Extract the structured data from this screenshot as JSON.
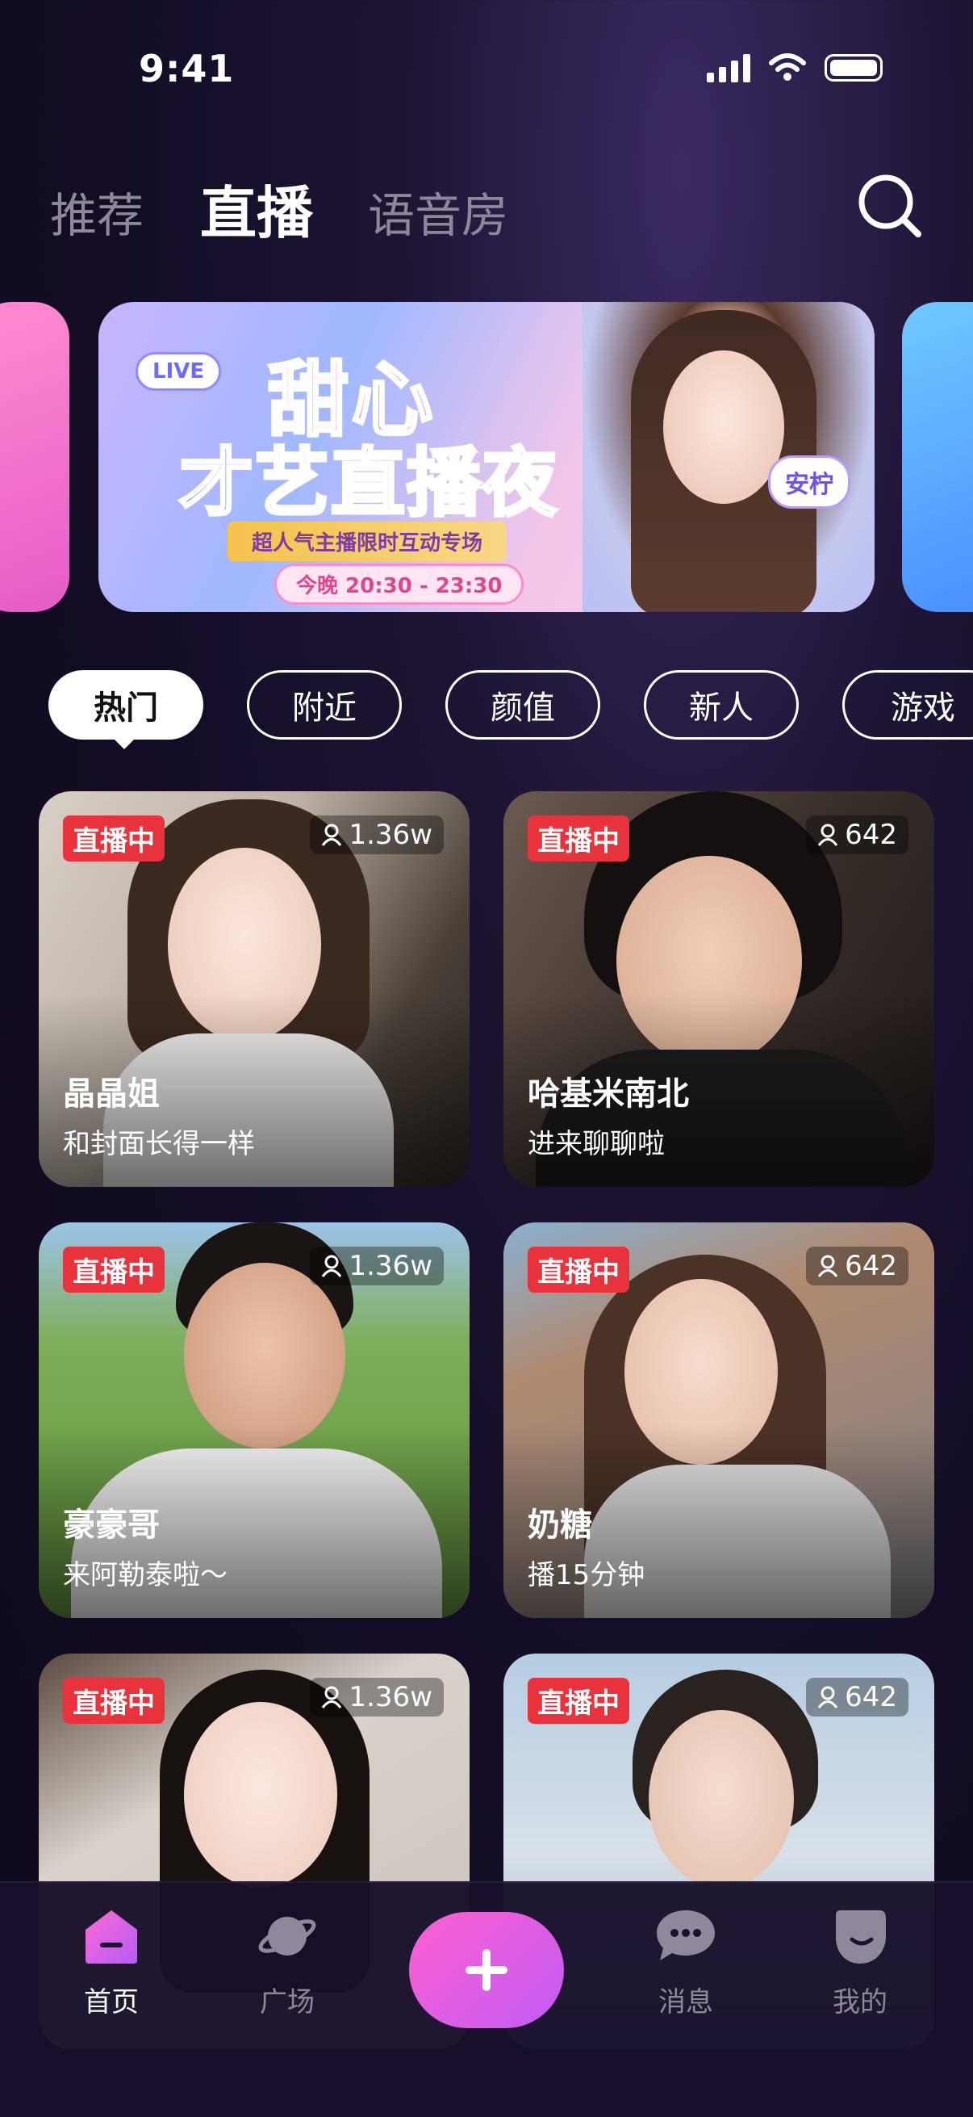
{
  "status_bar": {
    "time": "9:41"
  },
  "top_tabs": [
    {
      "label": "推荐",
      "active": false
    },
    {
      "label": "直播",
      "active": true
    },
    {
      "label": "语音房",
      "active": false
    }
  ],
  "banner": {
    "live_tag": "LIVE",
    "title_line1": "甜心",
    "title_line2": "才艺直播夜",
    "subtitle": "超人气主播限时互动专场",
    "time": "今晚 20:30 - 23:30",
    "host_name": "安柠"
  },
  "categories": [
    {
      "label": "热门",
      "active": true
    },
    {
      "label": "附近",
      "active": false
    },
    {
      "label": "颜值",
      "active": false
    },
    {
      "label": "新人",
      "active": false
    },
    {
      "label": "游戏",
      "active": false
    }
  ],
  "streams": [
    {
      "live": "直播中",
      "viewers": "1.36w",
      "name": "晶晶姐",
      "desc": "和封面长得一样"
    },
    {
      "live": "直播中",
      "viewers": "642",
      "name": "哈基米南北",
      "desc": "进来聊聊啦"
    },
    {
      "live": "直播中",
      "viewers": "1.36w",
      "name": "豪豪哥",
      "desc": "来阿勒泰啦～"
    },
    {
      "live": "直播中",
      "viewers": "642",
      "name": "奶糖",
      "desc": "播15分钟"
    },
    {
      "live": "直播中",
      "viewers": "1.36w",
      "name": "",
      "desc": ""
    },
    {
      "live": "直播中",
      "viewers": "642",
      "name": "",
      "desc": ""
    }
  ],
  "bottom_nav": [
    {
      "label": "首页",
      "icon": "home-icon",
      "active": true
    },
    {
      "label": "广场",
      "icon": "planet-icon",
      "active": false
    },
    {
      "label": "",
      "icon": "plus-icon",
      "active": false
    },
    {
      "label": "消息",
      "icon": "message-icon",
      "active": false
    },
    {
      "label": "我的",
      "icon": "profile-icon",
      "active": false
    }
  ],
  "colors": {
    "accent_pink": "#ff5fd0",
    "accent_purple": "#c05cf5",
    "live_red": "#e8323c",
    "background": "#130c24"
  }
}
